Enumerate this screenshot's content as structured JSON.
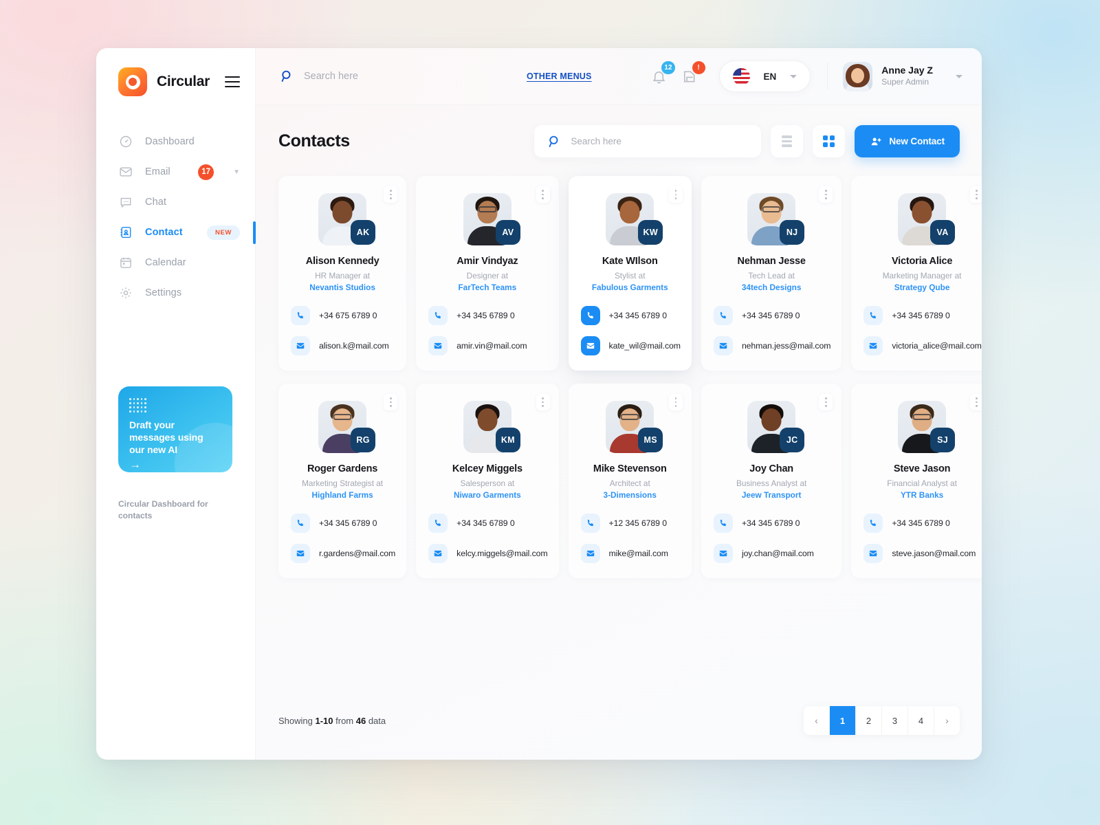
{
  "brand": {
    "name": "Circular",
    "logo_icon": "circular-logo",
    "menu_icon": "hamburger-menu-icon"
  },
  "sidebar": {
    "items": [
      {
        "label": "Dashboard",
        "icon": "gauge-icon",
        "active": false
      },
      {
        "label": "Email",
        "icon": "envelope-icon",
        "active": false,
        "badge": "17",
        "chevron": "chevron-down-icon"
      },
      {
        "label": "Chat",
        "icon": "chat-bubble-icon",
        "active": false
      },
      {
        "label": "Contact",
        "icon": "contact-book-icon",
        "active": true,
        "tag": "NEW"
      },
      {
        "label": "Calendar",
        "icon": "calendar-icon",
        "active": false
      },
      {
        "label": "Settings",
        "icon": "gear-icon",
        "active": false
      }
    ],
    "promo": {
      "line1": "Draft your",
      "line2": "messages using",
      "line3": "our new AI",
      "arrow": "→"
    },
    "caption": "Circular Dashboard for contacts"
  },
  "topbar": {
    "search_placeholder": "Search here",
    "search_value": "",
    "search_icon": "search-icon",
    "other_menus": "OTHER MENUS",
    "bell_icon": "bell-icon",
    "bell_badge": "12",
    "inbox_icon": "inbox-icon",
    "inbox_badge": "!",
    "language": "EN",
    "flag_icon": "us-flag-icon",
    "user_name": "Anne Jay Z",
    "user_role": "Super Admin",
    "avatar": "user-avatar"
  },
  "page": {
    "title": "Contacts",
    "search_placeholder": "Search here",
    "search_value": "",
    "list_view_icon": "list-view-icon",
    "grid_view_icon": "grid-view-icon",
    "new_contact_label": "New Contact",
    "new_contact_icon": "add-user-icon",
    "accent_color": "#1b8cf4"
  },
  "contacts": [
    {
      "name": "Alison Kennedy",
      "role": "HR Manager at",
      "org": "Nevantis Studios",
      "phone": "+34 675 6789 0",
      "email": "alison.k@mail.com",
      "initials": "AK",
      "highlight": false,
      "photo": {
        "hair": "#2d1a10",
        "skin": "#7c4a2c",
        "body": "#eef1f5",
        "glasses": false
      }
    },
    {
      "name": "Amir Vindyaz",
      "role": "Designer at",
      "org": "FarTech Teams",
      "phone": "+34 345 6789 0",
      "email": "amir.vin@mail.com",
      "initials": "AV",
      "highlight": false,
      "photo": {
        "hair": "#20150f",
        "skin": "#b47c52",
        "body": "#25262b",
        "glasses": true
      }
    },
    {
      "name": "Kate WIlson",
      "role": "Stylist at",
      "org": "Fabulous Garments",
      "phone": "+34 345 6789 0",
      "email": "kate_wil@mail.com",
      "initials": "KW",
      "highlight": true,
      "photo": {
        "hair": "#3a2415",
        "skin": "#a8663c",
        "body": "#c9ccd2",
        "glasses": false
      }
    },
    {
      "name": "Nehman Jesse",
      "role": "Tech Lead at",
      "org": "34tech Designs",
      "phone": "+34 345 6789 0",
      "email": "nehman.jess@mail.com",
      "initials": "NJ",
      "highlight": false,
      "photo": {
        "hair": "#6e4a27",
        "skin": "#e9bb91",
        "body": "#7ea2c6",
        "glasses": true
      }
    },
    {
      "name": "Victoria Alice",
      "role": "Marketing Manager at",
      "org": "Strategy Qube",
      "phone": "+34 345 6789 0",
      "email": "victoria_alice@mail.com",
      "initials": "VA",
      "highlight": false,
      "photo": {
        "hair": "#241710",
        "skin": "#8a5130",
        "body": "#ddd9d4",
        "glasses": false
      }
    },
    {
      "name": "Roger Gardens",
      "role": "Marketing Strategist at",
      "org": "Highland Farms",
      "phone": "+34 345 6789 0",
      "email": "r.gardens@mail.com",
      "initials": "RG",
      "highlight": false,
      "photo": {
        "hair": "#4a3220",
        "skin": "#e6b68c",
        "body": "#4a3f63",
        "glasses": true
      }
    },
    {
      "name": "Kelcey Miggels",
      "role": "Salesperson at",
      "org": "Niwaro Garments",
      "phone": "+34 345 6789 0",
      "email": "kelcy.miggels@mail.com",
      "initials": "KM",
      "highlight": false,
      "photo": {
        "hair": "#191210",
        "skin": "#7e4b2c",
        "body": "#e6e8ec",
        "glasses": false
      }
    },
    {
      "name": "Mike Stevenson",
      "role": "Architect at",
      "org": "3-Dimensions",
      "phone": "+12 345 6789 0",
      "email": "mike@mail.com",
      "initials": "MS",
      "highlight": false,
      "photo": {
        "hair": "#2a1d13",
        "skin": "#e3b289",
        "body": "#a8392f",
        "glasses": true
      }
    },
    {
      "name": "Joy Chan",
      "role": "Business Analyst at",
      "org": "Jeew Transport",
      "phone": "+34 345 6789 0",
      "email": "joy.chan@mail.com",
      "initials": "JC",
      "highlight": false,
      "photo": {
        "hair": "#130d0a",
        "skin": "#6f4026",
        "body": "#1d2128",
        "glasses": false
      }
    },
    {
      "name": "Steve Jason",
      "role": "Financial Analyst at",
      "org": "YTR Banks",
      "phone": "+34 345 6789 0",
      "email": "steve.jason@mail.com",
      "initials": "SJ",
      "highlight": false,
      "photo": {
        "hair": "#3b2a1a",
        "skin": "#e0ae84",
        "body": "#17181c",
        "glasses": true
      }
    }
  ],
  "footer": {
    "showing_prefix": "Showing ",
    "range": "1-10",
    "showing_mid": " from ",
    "total": "46",
    "showing_suffix": " data",
    "prev_icon": "chevron-left-icon",
    "next_icon": "chevron-right-icon",
    "pages": [
      "1",
      "2",
      "3",
      "4"
    ],
    "current_page": "1"
  }
}
